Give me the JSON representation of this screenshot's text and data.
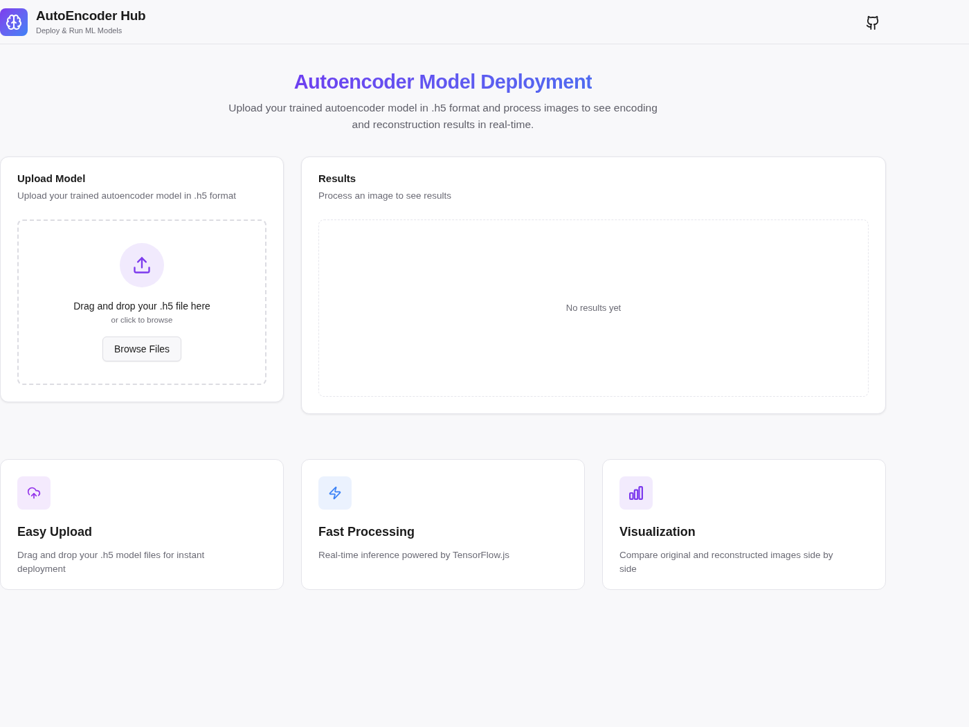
{
  "header": {
    "title": "AutoEncoder Hub",
    "subtitle": "Deploy & Run ML Models"
  },
  "hero": {
    "title": "Autoencoder Model Deployment",
    "subtitle": "Upload your trained autoencoder model in .h5 format and process images to see encoding and reconstruction results in real-time."
  },
  "upload_card": {
    "title": "Upload Model",
    "description": "Upload your trained autoencoder model in .h5 format",
    "dropzone": {
      "prompt": "Drag and drop your .h5 file here",
      "hint": "or click to browse",
      "button": "Browse Files"
    }
  },
  "results_card": {
    "title": "Results",
    "description": "Process an image to see results",
    "empty_text": "No results yet"
  },
  "features": [
    {
      "kind": "upload",
      "color": "#9333ea",
      "title": "Easy Upload",
      "description": "Drag and drop your .h5 model files for instant deployment"
    },
    {
      "kind": "speed",
      "color": "#3b82f6",
      "title": "Fast Processing",
      "description": "Real-time inference powered by TensorFlow.js"
    },
    {
      "kind": "chart",
      "color": "#7c3aed",
      "title": "Visualization",
      "description": "Compare original and reconstructed images side by side"
    }
  ]
}
